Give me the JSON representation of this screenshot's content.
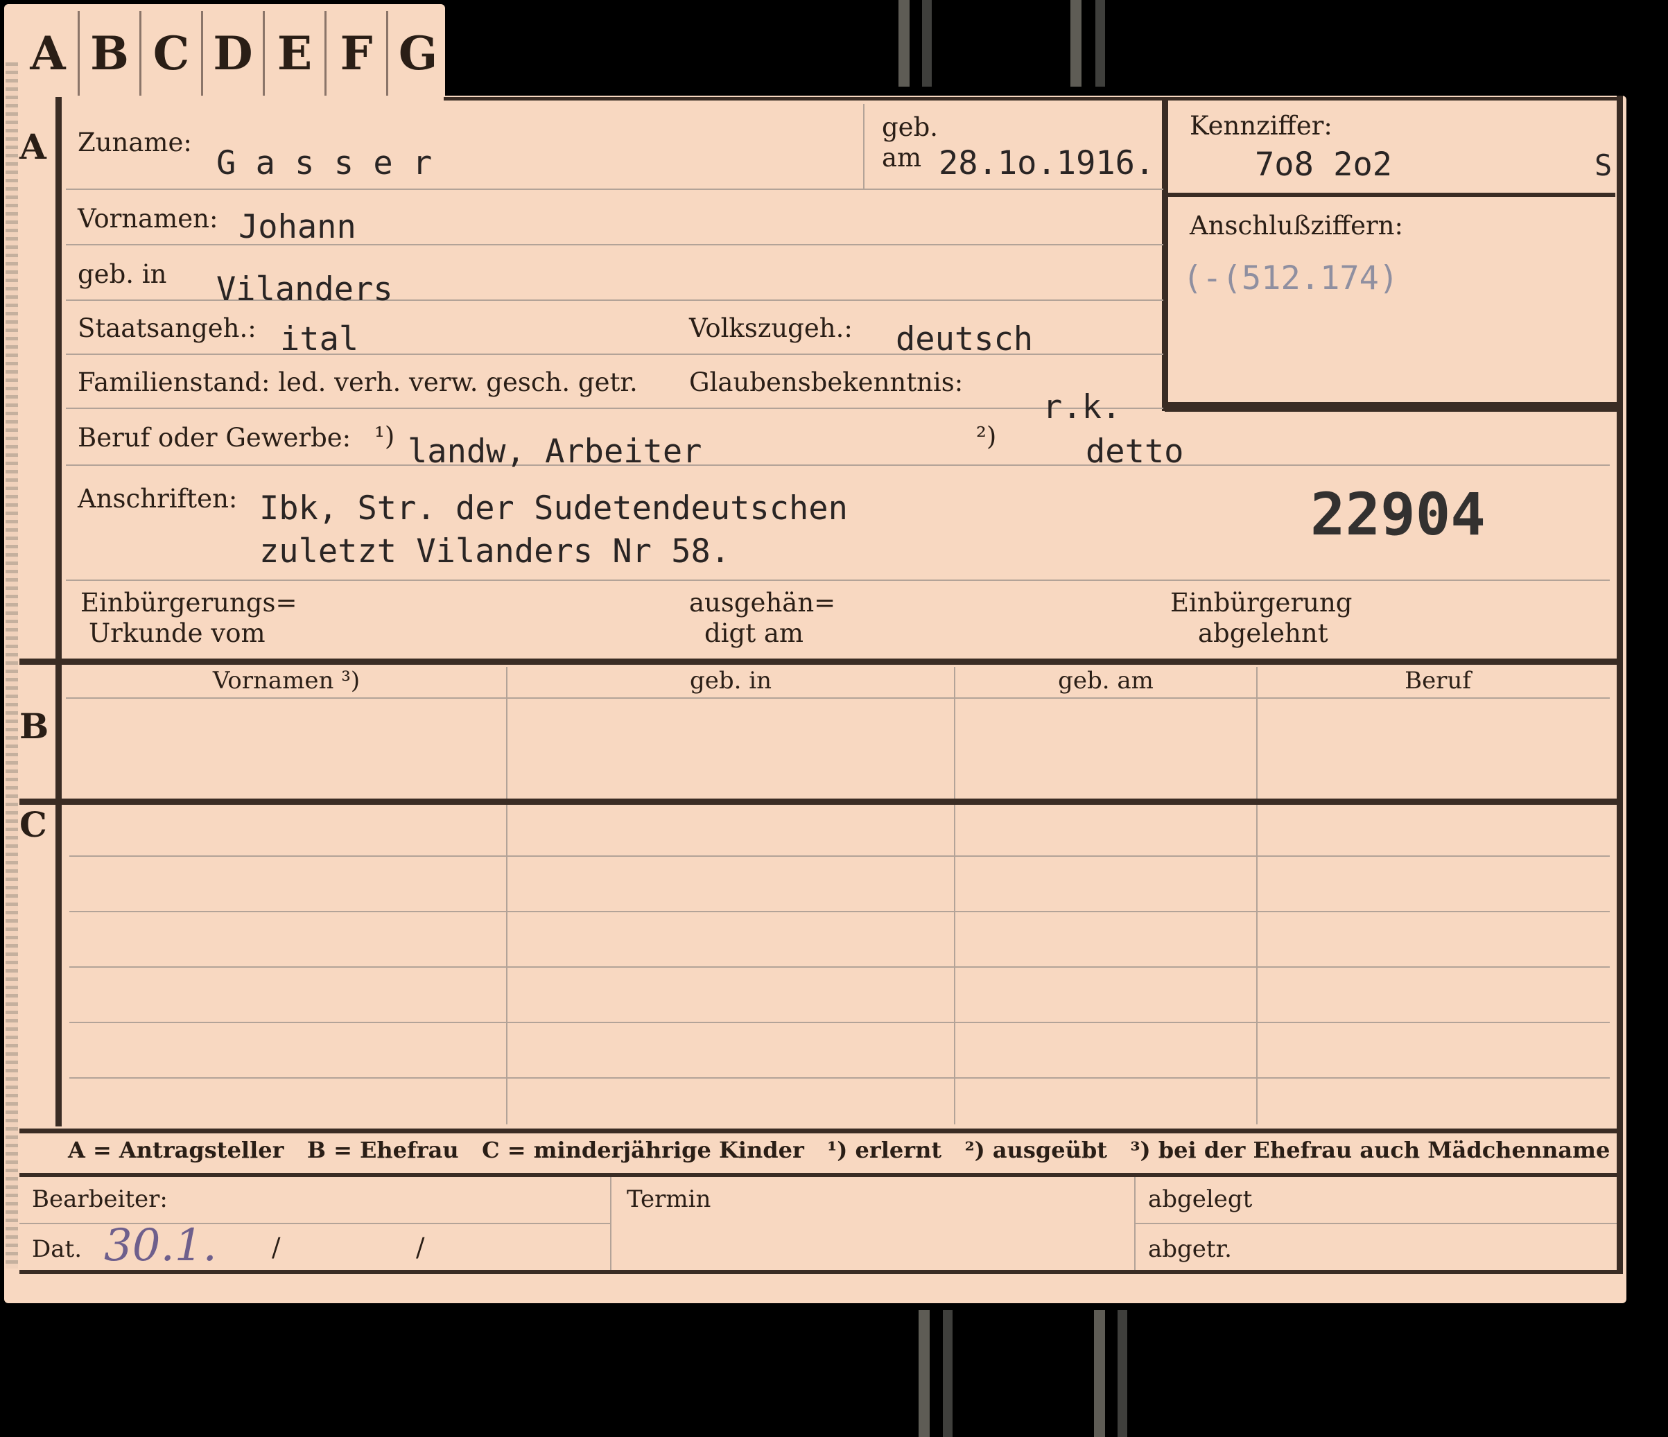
{
  "tabs": [
    "A",
    "B",
    "C",
    "D",
    "E",
    "F",
    "G"
  ],
  "sections": {
    "a": "A",
    "b": "B",
    "c": "C"
  },
  "labels": {
    "zuname": "Zuname:",
    "geb": "geb.",
    "am": "am",
    "kennziffer": "Kennziffer:",
    "vornamen": "Vornamen:",
    "anschlussziffern": "Anschlußziffern:",
    "geb_in": "geb. in",
    "staatsangeh": "Staatsangeh.:",
    "volkszugeh": "Volkszugeh.:",
    "familienstand": "Familienstand: led. verh. verw. gesch. getr.",
    "glaubensbekenntnis": "Glaubensbekenntnis:",
    "beruf": "Beruf oder Gewerbe:",
    "fn1": "¹)",
    "fn2": "²)",
    "anschriften": "Anschriften:",
    "einb_urkunde_1": "Einbürgerungs=",
    "einb_urkunde_2": "Urkunde vom",
    "ausgehaen_1": "ausgehän=",
    "ausgehaen_2": "digt am",
    "einb_abgelehnt_1": "Einbürgerung",
    "einb_abgelehnt_2": "abgelehnt"
  },
  "values": {
    "zuname": "G a s s e r",
    "geb_am": "28.1o.1916.",
    "kennziffer": "7o8 2o2",
    "kennziffer_suffix": "S",
    "vornamen": "Johann",
    "anschlussziffern": "(-(512.174)",
    "geb_in": "Vilanders",
    "staatsangeh": "ital",
    "volkszugeh": "deutsch",
    "glaubensbekenntnis": "r.k.",
    "beruf_erlernt": "landw, Arbeiter",
    "beruf_ausgeuebt": "detto",
    "anschrift_1": "Ibk, Str. der Sudetendeutschen",
    "anschrift_2": "zuletzt Vilanders Nr 58.",
    "stamp_number": "22904"
  },
  "table": {
    "columns": [
      "Vornamen ³)",
      "geb. in",
      "geb. am",
      "Beruf"
    ]
  },
  "legend": "A = Antragsteller   B = Ehefrau   C = minderjährige Kinder   ¹) erlernt   ²) ausgeübt   ³) bei der Ehefrau auch Mädchenname",
  "footer": {
    "bearbeiter": "Bearbeiter:",
    "termin": "Termin",
    "abgelegt": "abgelegt",
    "dat": "Dat.",
    "dat_value": "30.1.",
    "slash1": "/",
    "slash2": "/",
    "abgetr": "abgetr."
  },
  "colors": {
    "card": "#f8d8c1",
    "ink": "#2a1e16",
    "typewriter": "#2a2524",
    "stamp_purple": "#6e5f8c",
    "pencil": "#8f8fa0"
  }
}
